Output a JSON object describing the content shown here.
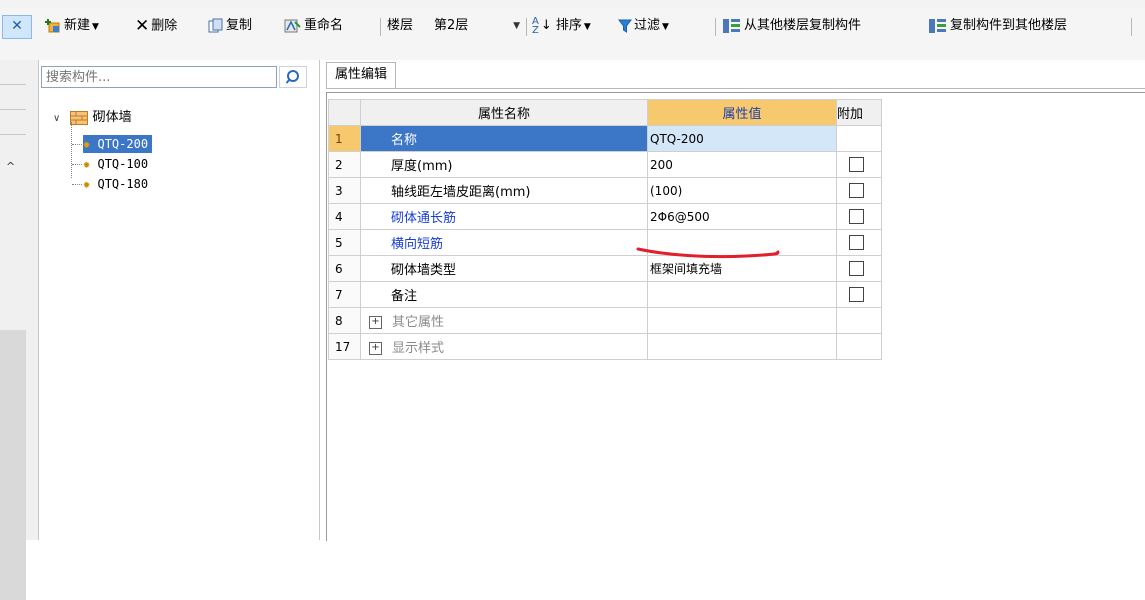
{
  "toolbar": {
    "new": "新建",
    "delete": "删除",
    "copy": "复制",
    "rename": "重命名",
    "floor_label": "楼层",
    "floor_value": "第2层",
    "sort": "排序",
    "filter": "过滤",
    "copy_from_floor": "从其他楼层复制构件",
    "copy_to_floor": "复制构件到其他楼层"
  },
  "tree": {
    "search_placeholder": "搜索构件...",
    "root_label": "砌体墙",
    "items": [
      {
        "label": "QTQ-200",
        "selected": true
      },
      {
        "label": "QTQ-100",
        "selected": false
      },
      {
        "label": "QTQ-180",
        "selected": false
      }
    ]
  },
  "properties": {
    "tab_label": "属性编辑",
    "headers": {
      "name": "属性名称",
      "value": "属性值",
      "extra": "附加"
    },
    "rows": [
      {
        "num": "1",
        "name": "名称",
        "value": "QTQ-200",
        "checkbox": false,
        "selected": true
      },
      {
        "num": "2",
        "name": "厚度(mm)",
        "value": "200",
        "checkbox": true
      },
      {
        "num": "3",
        "name": "轴线距左墙皮距离(mm)",
        "value": "(100)",
        "checkbox": true
      },
      {
        "num": "4",
        "name": "砌体通长筋",
        "value": "2Φ6@500",
        "checkbox": true,
        "blue": true
      },
      {
        "num": "5",
        "name": "横向短筋",
        "value": "",
        "checkbox": true,
        "blue": true
      },
      {
        "num": "6",
        "name": "砌体墙类型",
        "value": "框架间填充墙",
        "checkbox": true
      },
      {
        "num": "7",
        "name": "备注",
        "value": "",
        "checkbox": true
      },
      {
        "num": "8",
        "name": "其它属性",
        "value": "",
        "checkbox": false,
        "expand": true
      },
      {
        "num": "17",
        "name": "显示样式",
        "value": "",
        "checkbox": false,
        "expand": true
      }
    ]
  },
  "colors": {
    "accent": "#3c76c7",
    "header_value_bg": "#f7c96e",
    "annotation_red": "#e0202a"
  }
}
